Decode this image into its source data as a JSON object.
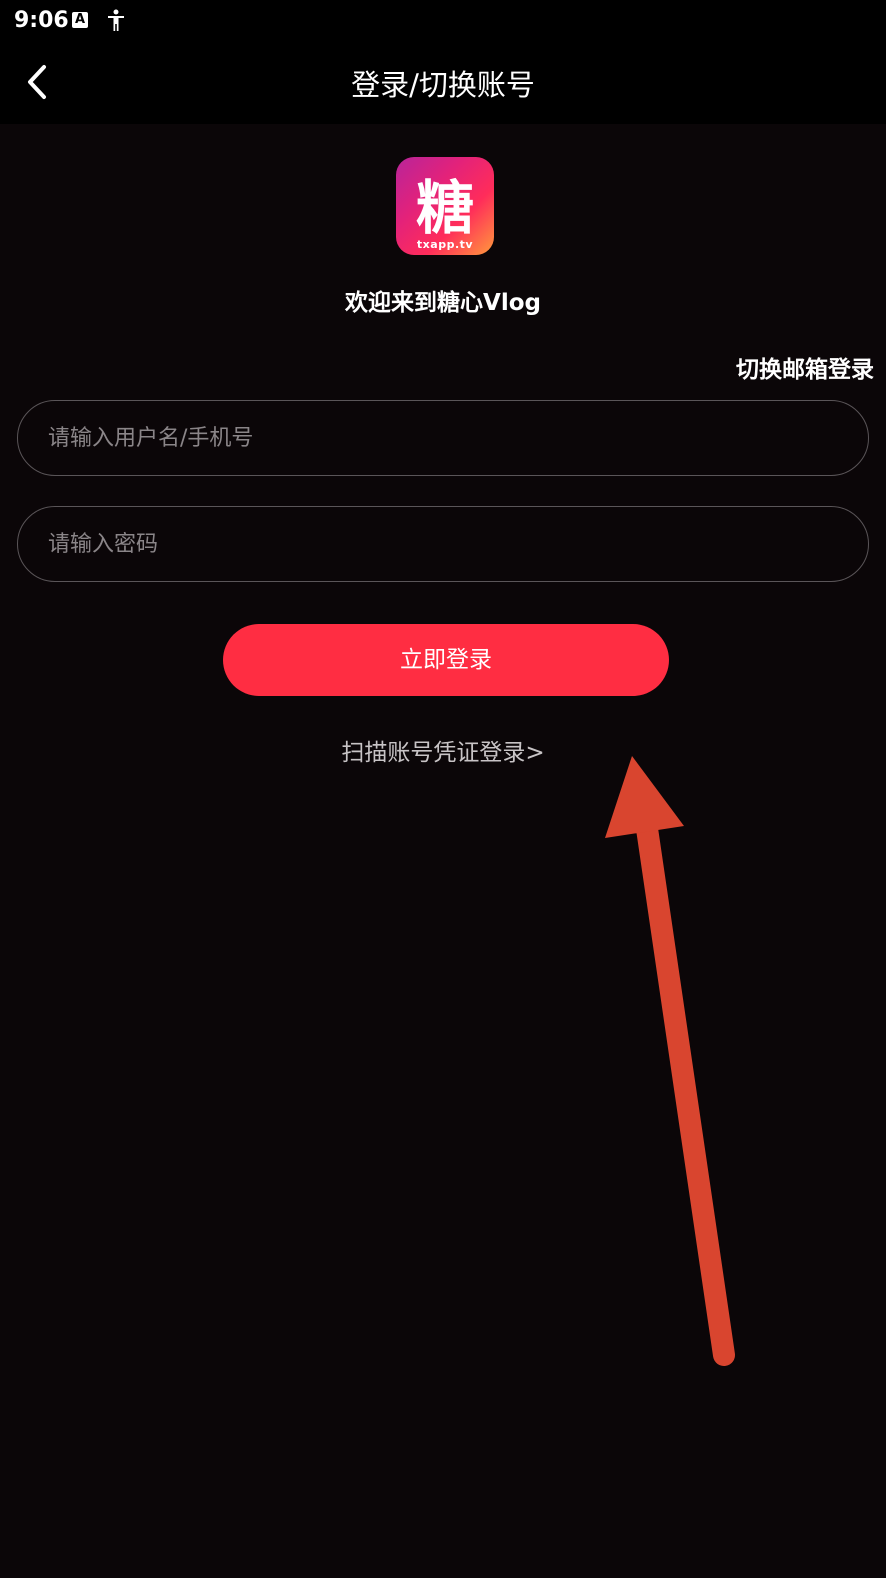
{
  "status_bar": {
    "time": "9:06",
    "icons": [
      "a-notification-icon",
      "accessibility-icon"
    ]
  },
  "nav": {
    "title": "登录/切换账号",
    "back_icon": "chevron-left-icon"
  },
  "logo": {
    "glyph": "糖",
    "url_text": "txapp.tv"
  },
  "welcome": "欢迎来到糖心Vlog",
  "switch_email": "切换邮箱登录",
  "form": {
    "username_placeholder": "请输入用户名/手机号",
    "password_placeholder": "请输入密码",
    "login_label": "立即登录"
  },
  "scan_link": "扫描账号凭证登录>",
  "colors": {
    "background": "#0b0608",
    "accent": "#ff2d42",
    "annotation": "#d9452f"
  }
}
